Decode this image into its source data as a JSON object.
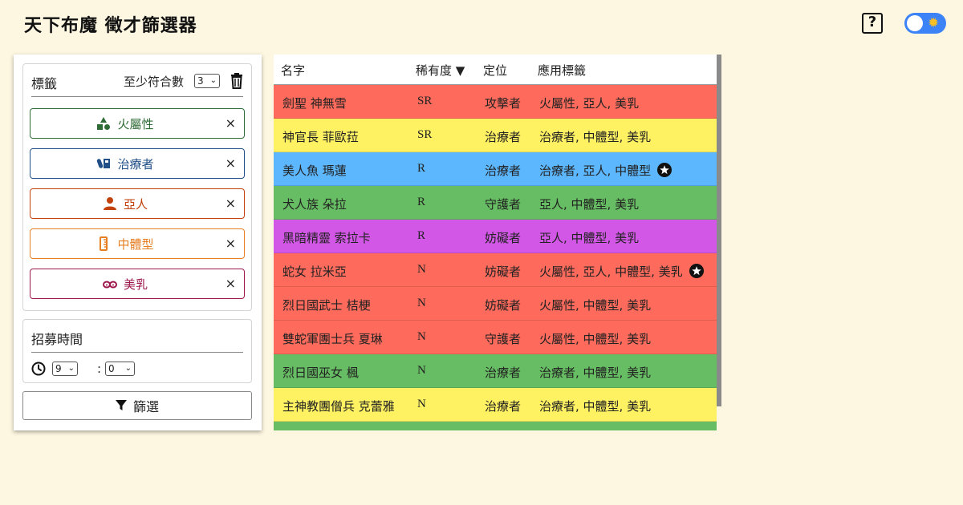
{
  "app": {
    "title": "天下布魔 徵才篩選器",
    "help_label": "?"
  },
  "colors": {
    "background": "#fdf7e1",
    "red": "#fe6b5c",
    "yellow": "#fef262",
    "blue": "#5cb7fe",
    "green": "#67bd63",
    "purple": "#d357e6",
    "toggle": "#3b83f6"
  },
  "tags_panel": {
    "label": "標籤",
    "min_match_label": "至少符合數",
    "min_match_value": "3",
    "clear_icon": "trash-icon",
    "tags": [
      {
        "label": "火屬性",
        "icon": "shapes-icon",
        "color": "#2e6b35"
      },
      {
        "label": "治療者",
        "icon": "medicine-icon",
        "color": "#1f4f86"
      },
      {
        "label": "亞人",
        "icon": "person-icon",
        "color": "#c2410c"
      },
      {
        "label": "中體型",
        "icon": "ruler-icon",
        "color": "#e67e22"
      },
      {
        "label": "美乳",
        "icon": "bust-icon",
        "color": "#9d174d"
      }
    ],
    "remove_label": "×"
  },
  "time_panel": {
    "label": "招募時間",
    "hour": "9",
    "colon": ":",
    "minute": "0"
  },
  "filter_button": {
    "label": "篩選",
    "icon": "funnel-icon"
  },
  "table": {
    "headers": {
      "name": "名字",
      "rarity": "稀有度 ▼",
      "role": "定位",
      "tags": "應用標籤"
    },
    "rows": [
      {
        "name": "劍聖 神無雪",
        "rarity": "SR",
        "role": "攻擊者",
        "tags": "火屬性, 亞人, 美乳",
        "color": "#fe6b5c",
        "star": false
      },
      {
        "name": "神官長 菲歐菈",
        "rarity": "SR",
        "role": "治療者",
        "tags": "治療者, 中體型, 美乳",
        "color": "#fef262",
        "star": false
      },
      {
        "name": "美人魚 瑪蓮",
        "rarity": "R",
        "role": "治療者",
        "tags": "治療者, 亞人, 中體型",
        "color": "#5cb7fe",
        "star": true
      },
      {
        "name": "犬人族 朵拉",
        "rarity": "R",
        "role": "守護者",
        "tags": "亞人, 中體型, 美乳",
        "color": "#67bd63",
        "star": false
      },
      {
        "name": "黑暗精靈 索拉卡",
        "rarity": "R",
        "role": "妨礙者",
        "tags": "亞人, 中體型, 美乳",
        "color": "#d357e6",
        "star": false
      },
      {
        "name": "蛇女 拉米亞",
        "rarity": "N",
        "role": "妨礙者",
        "tags": "火屬性, 亞人, 中體型, 美乳",
        "color": "#fe6b5c",
        "star": true
      },
      {
        "name": "烈日國武士 桔梗",
        "rarity": "N",
        "role": "妨礙者",
        "tags": "火屬性, 中體型, 美乳",
        "color": "#fe6b5c",
        "star": false
      },
      {
        "name": "雙蛇軍團士兵 夏琳",
        "rarity": "N",
        "role": "守護者",
        "tags": "火屬性, 中體型, 美乳",
        "color": "#fe6b5c",
        "star": false
      },
      {
        "name": "烈日國巫女 楓",
        "rarity": "N",
        "role": "治療者",
        "tags": "治療者, 中體型, 美乳",
        "color": "#67bd63",
        "star": false
      },
      {
        "name": "主神教團僧兵 克蕾雅",
        "rarity": "N",
        "role": "治療者",
        "tags": "治療者, 中體型, 美乳",
        "color": "#fef262",
        "star": false
      },
      {
        "name": "",
        "rarity": "",
        "role": "",
        "tags": "",
        "color": "#67bd63",
        "star": false
      }
    ]
  }
}
